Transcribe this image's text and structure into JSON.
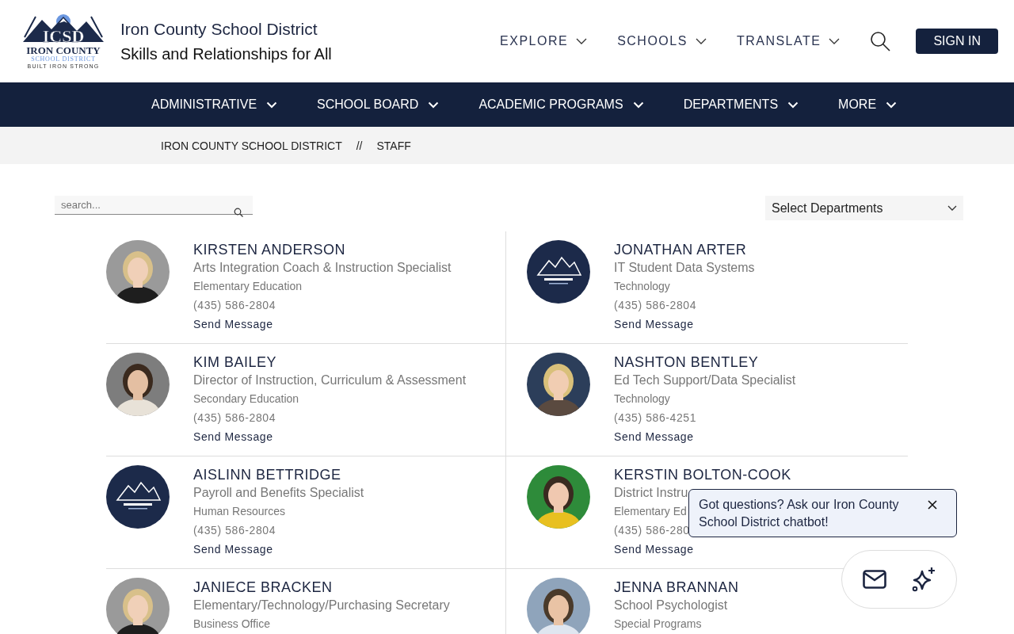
{
  "header": {
    "logo": {
      "letters": "ICSD",
      "name": "IRON COUNTY",
      "sub": "SCHOOL DISTRICT",
      "motto": "BUILT IRON STRONG"
    },
    "title": "Iron County School District",
    "tagline": "Skills and Relationships for All",
    "top_nav": [
      {
        "label": "EXPLORE"
      },
      {
        "label": "SCHOOLS"
      },
      {
        "label": "TRANSLATE"
      }
    ],
    "sign_in": "SIGN IN"
  },
  "main_nav": [
    {
      "label": "ADMINISTRATIVE"
    },
    {
      "label": "SCHOOL BOARD"
    },
    {
      "label": "ACADEMIC PROGRAMS"
    },
    {
      "label": "DEPARTMENTS"
    },
    {
      "label": "MORE"
    }
  ],
  "breadcrumb": {
    "items": [
      "IRON COUNTY SCHOOL DISTRICT",
      "STAFF"
    ],
    "separator": "//"
  },
  "search": {
    "placeholder": "search..."
  },
  "department_select": "Select Departments",
  "staff": [
    {
      "name": "KIRSTEN ANDERSON",
      "title": "Arts Integration Coach & Instruction Specialist",
      "department": "Elementary Education",
      "phone": "(435) 586-2804",
      "action": "Send Message",
      "kind": "picture"
    },
    {
      "name": "JONATHAN ARTER",
      "title": "IT Student Data Systems",
      "department": "Technology",
      "phone": "(435) 586-2804",
      "action": "Send Message",
      "kind": "logo"
    },
    {
      "name": "KIM BAILEY",
      "title": "Director of Instruction, Curriculum & Assessment",
      "department": "Secondary Education",
      "phone": "(435) 586-2804",
      "action": "Send Message",
      "kind": "picture"
    },
    {
      "name": "NASHTON BENTLEY",
      "title": "Ed Tech Support/Data Specialist",
      "department": "Technology",
      "phone": "(435) 586-4251",
      "action": "Send Message",
      "kind": "picture"
    },
    {
      "name": "AISLINN BETTRIDGE",
      "title": "Payroll and Benefits Specialist",
      "department": "Human Resources",
      "phone": "(435) 586-2804",
      "action": "Send Message",
      "kind": "logo"
    },
    {
      "name": "KERSTIN BOLTON-COOK",
      "title": "District Instru",
      "department": "Elementary Ed",
      "phone": "(435) 586-280",
      "action": "Send Message",
      "kind": "picture"
    },
    {
      "name": "JANIECE BRACKEN",
      "title": "Elementary/Technology/Purchasing Secretary",
      "department": "Business Office",
      "kind": "picture"
    },
    {
      "name": "JENNA BRANNAN",
      "title": "School Psychologist",
      "department": "Special Programs",
      "kind": "picture"
    }
  ],
  "chat": {
    "tooltip": "Got questions? Ask our Iron County School District chatbot!"
  }
}
